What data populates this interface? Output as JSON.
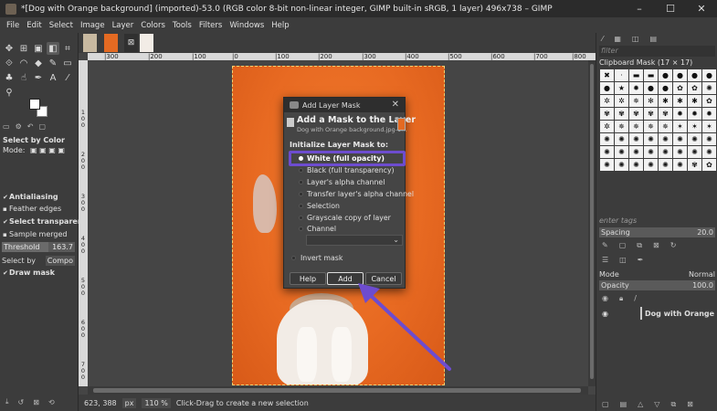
{
  "window": {
    "title": "*[Dog with Orange background] (imported)-53.0 (RGB color 8-bit non-linear integer, GIMP built-in sRGB, 1 layer) 496x738 – GIMP",
    "minimize": "–",
    "maximize": "☐",
    "close": "✕"
  },
  "menu": [
    "File",
    "Edit",
    "Select",
    "Image",
    "Layer",
    "Colors",
    "Tools",
    "Filters",
    "Windows",
    "Help"
  ],
  "ruler": {
    "h": [
      "|300",
      "|200",
      "|100",
      "|0",
      "|100",
      "|200",
      "|300",
      "|400",
      "|500",
      "|600",
      "|700",
      "|800"
    ],
    "v": [
      "1\n0\n0",
      "2\n0\n0",
      "3\n0\n0",
      "4\n0\n0",
      "5\n0\n0",
      "6\n0\n0",
      "7\n0\n0"
    ]
  },
  "tool_options": {
    "title": "Select by Color",
    "mode_label": "Mode:",
    "antialiasing": "Antialiasing",
    "feather_edges": "Feather edges",
    "select_transparent": "Select transparent",
    "sample_merged": "Sample merged",
    "threshold_label": "Threshold",
    "threshold_value": "163.7",
    "threshold_fraction": 0.64,
    "select_by_label": "Select by",
    "select_by_value": "Compo",
    "draw_mask": "Draw mask"
  },
  "status": {
    "coords": "623, 388",
    "unit": "px",
    "zoom": "110 %",
    "message": "Click-Drag to create a new selection"
  },
  "brushes": {
    "filter_placeholder": "filter",
    "title": "Clipboard Mask (17 × 17)",
    "tags_placeholder": "enter tags",
    "spacing_label": "Spacing",
    "spacing_value": "20.0"
  },
  "layers": {
    "mode_label": "Mode",
    "mode_value": "Normal",
    "opacity_label": "Opacity",
    "opacity_value": "100.0",
    "layer_name": "Dog with Orange b"
  },
  "dialog": {
    "title": "Add Layer Mask",
    "heading": "Add a Mask to the Layer",
    "subtitle": "Dog with Orange background.jpg-1...",
    "init_label": "Initialize Layer Mask to:",
    "options": [
      "White (full opacity)",
      "Black (full transparency)",
      "Layer's alpha channel",
      "Transfer layer's alpha channel",
      "Selection",
      "Grayscale copy of layer",
      "Channel"
    ],
    "invert": "Invert mask",
    "help": "Help",
    "add": "Add",
    "cancel": "Cancel"
  },
  "colors": {
    "highlight": "#6d4ccf",
    "arrow": "#6d4ccf",
    "canvas_bg": "#e86a22"
  }
}
